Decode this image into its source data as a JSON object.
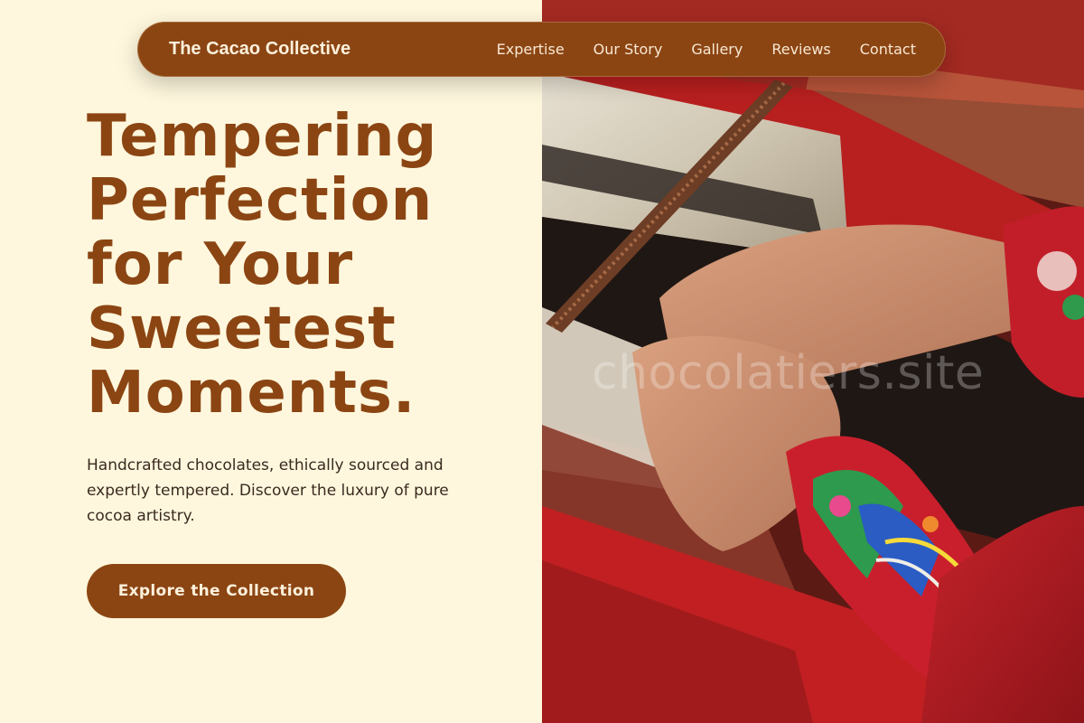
{
  "nav": {
    "brand": "The Cacao Collective",
    "links": [
      "Expertise",
      "Our Story",
      "Gallery",
      "Reviews",
      "Contact"
    ]
  },
  "hero": {
    "headline": "Tempering Perfection for Your Sweetest Moments.",
    "subtext": "Handcrafted chocolates, ethically sourced and expertly tempered. Discover the luxury of pure cocoa artistry.",
    "cta_label": "Explore the Collection",
    "image_watermark": "chocolatiers.site"
  },
  "colors": {
    "background": "#fef7dd",
    "brand_brown": "#8b4513",
    "text_dark": "#3b2a20",
    "nav_text": "#f8e8d2"
  },
  "icons": [
    "hero-weaving-photo"
  ]
}
